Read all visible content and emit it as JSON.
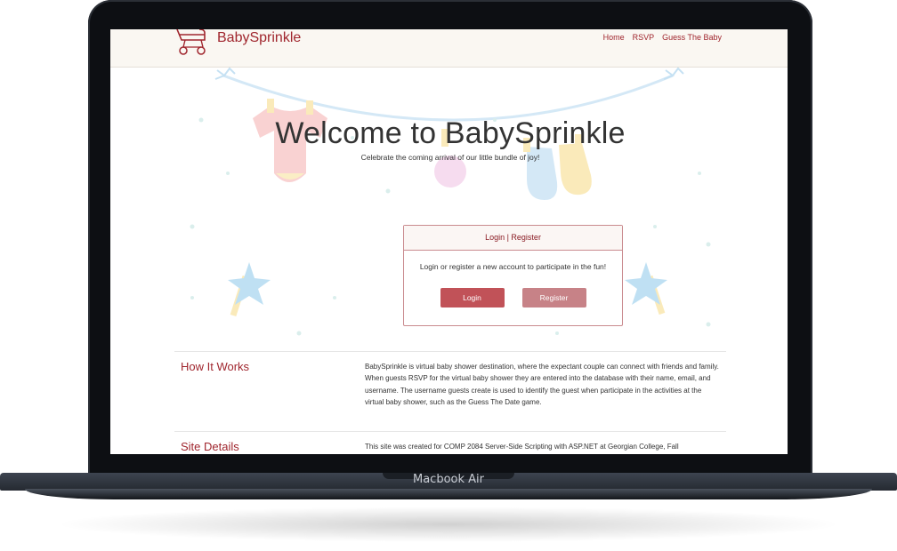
{
  "device": {
    "label": "Macbook Air"
  },
  "navbar": {
    "brand": "BabySprinkle",
    "links": [
      "Home",
      "RSVP",
      "Guess The Baby"
    ]
  },
  "hero": {
    "title": "Welcome to BabySprinkle",
    "subtitle": "Celebrate the coming arrival of our little bundle of joy!"
  },
  "card": {
    "header": "Login | Register",
    "body": "Login or register a new account to participate in the fun!",
    "login_label": "Login",
    "register_label": "Register"
  },
  "sections": [
    {
      "title": "How It Works",
      "text": "BabySprinkle is virtual baby shower destination, where the expectant couple can connect with friends and family. When guests RSVP for the virtual baby shower they are entered into the database with their name, email, and username. The username guests create is used to identify the guest when participate in the activities at the virtual baby shower, such as the Guess The Date game."
    },
    {
      "title": "Site Details",
      "text": "This site was created for COMP 2084 Server-Side Scripting with ASP.NET at Georgian College, Fall"
    }
  ],
  "colors": {
    "brand": "#a0262e",
    "login": "#c15258",
    "register": "#c78287",
    "navbar_bg": "#faf7f2"
  }
}
